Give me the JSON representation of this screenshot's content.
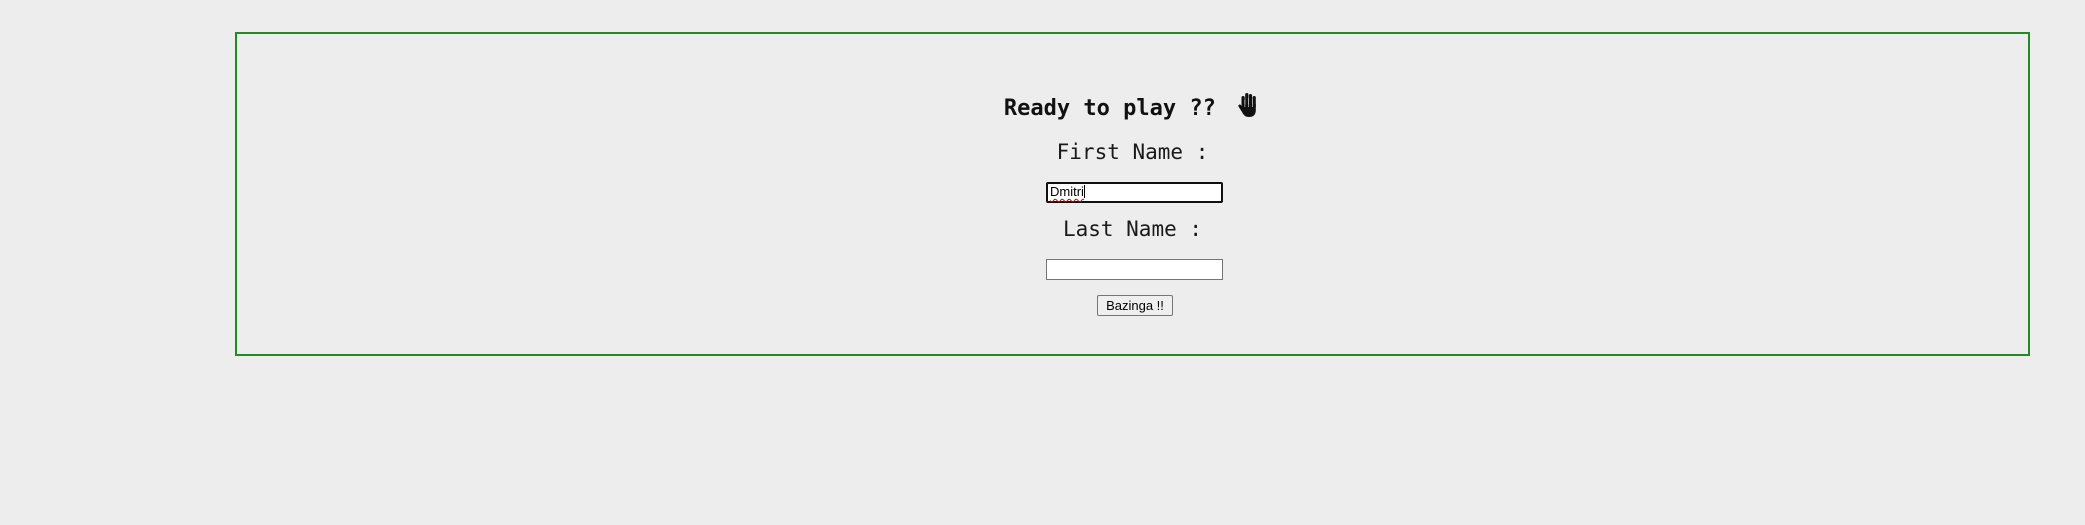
{
  "form": {
    "title": "Ready to play ??",
    "title_icon": "raised-hand-icon",
    "first_name_label": "First Name :",
    "first_name_value": "Dmitri",
    "last_name_label": "Last Name :",
    "last_name_value": "",
    "submit_label": "Bazinga !!"
  },
  "colors": {
    "background": "#ededed",
    "panel_border": "#228b22",
    "spellcheck_underline": "#d00000"
  }
}
